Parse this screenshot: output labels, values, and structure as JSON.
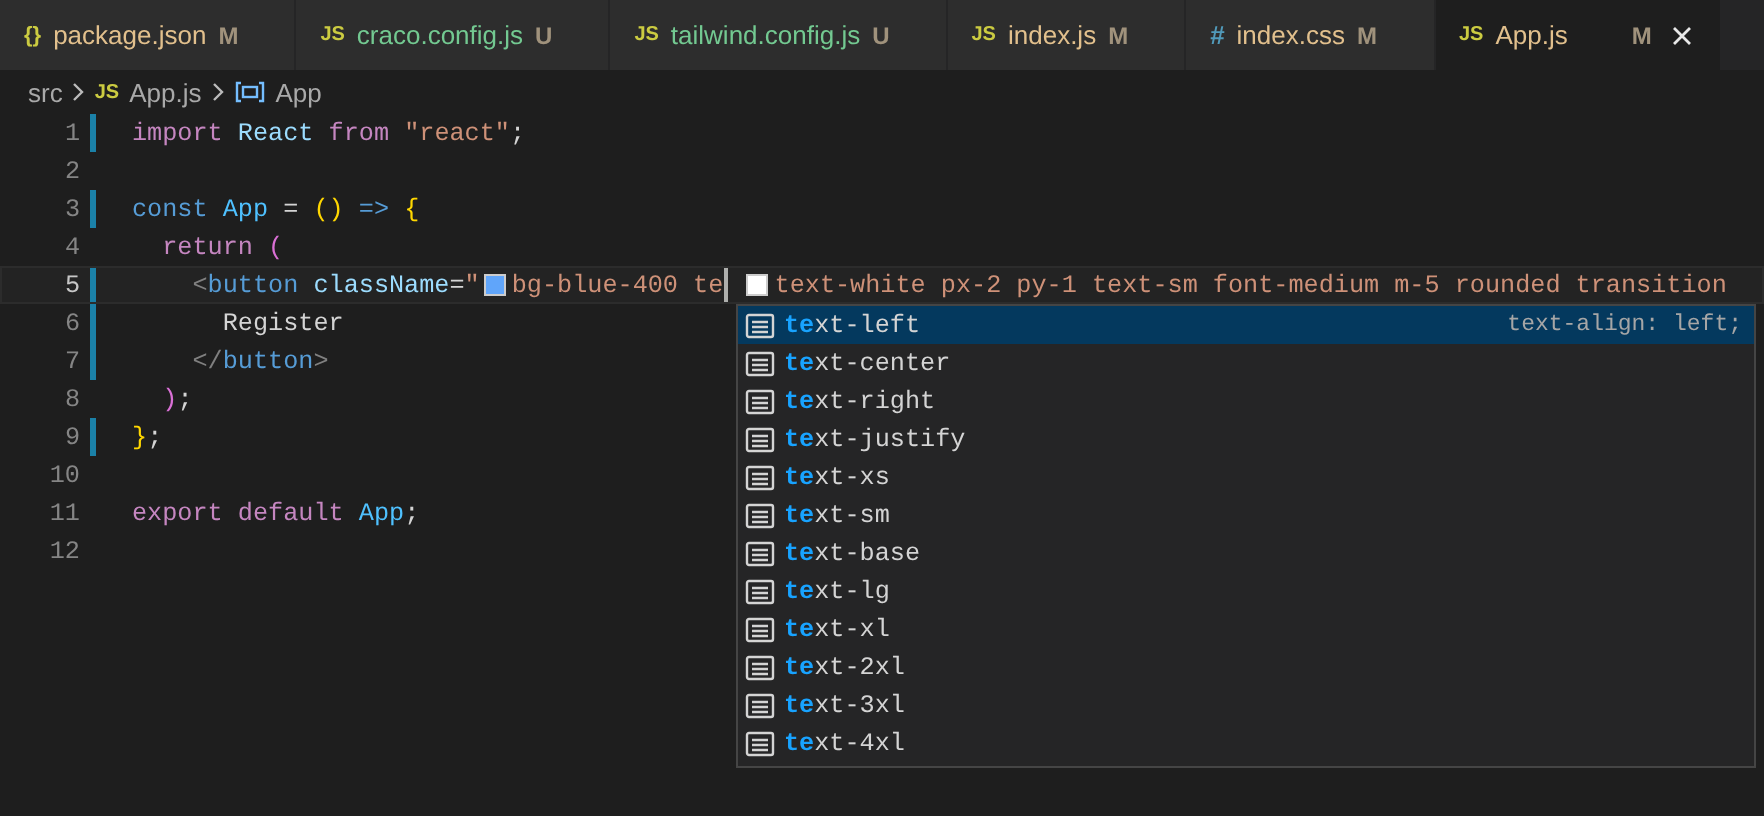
{
  "tabs": [
    {
      "icon": "{}",
      "kind": "json",
      "label": "package.json",
      "status": "M",
      "selected": false
    },
    {
      "icon": "JS",
      "kind": "js",
      "label": "craco.config.js",
      "status": "U",
      "selected": false
    },
    {
      "icon": "JS",
      "kind": "js",
      "label": "tailwind.config.js",
      "status": "U",
      "selected": false
    },
    {
      "icon": "JS",
      "kind": "js",
      "label": "index.js",
      "status": "M",
      "selected": false
    },
    {
      "icon": "#",
      "kind": "css",
      "label": "index.css",
      "status": "M",
      "selected": false
    },
    {
      "icon": "JS",
      "kind": "js",
      "label": "App.js",
      "status": "M",
      "selected": true
    }
  ],
  "breadcrumb": [
    {
      "kind": "folder",
      "label": "src"
    },
    {
      "kind": "file",
      "icon": "JS",
      "label": "App.js"
    },
    {
      "kind": "symbol",
      "label": "App"
    }
  ],
  "lines": [
    {
      "number": "1",
      "modified": true,
      "current": false,
      "tokens": [
        {
          "kind": "keyword",
          "text": "import"
        },
        {
          "kind": "variable",
          "text": " React"
        },
        {
          "kind": "keyword",
          "text": " from"
        },
        {
          "kind": "string",
          "text": " \"react\""
        },
        {
          "kind": "plain",
          "text": ";"
        }
      ]
    },
    {
      "number": "2",
      "modified": false,
      "current": false
    },
    {
      "number": "3",
      "modified": true,
      "current": false,
      "tokens": [
        {
          "kind": "storage",
          "text": "const"
        },
        {
          "kind": "constant",
          "text": " App"
        },
        {
          "kind": "plain",
          "text": " = "
        },
        {
          "kind": "bracket1",
          "text": "()"
        },
        {
          "kind": "storage",
          "text": " =>"
        },
        {
          "kind": "bracket1",
          "text": " {"
        }
      ]
    },
    {
      "number": "4",
      "modified": false,
      "current": false,
      "tokens": [
        {
          "kind": "keyword",
          "text": "  return"
        },
        {
          "kind": "bracket2",
          "text": " ("
        }
      ]
    },
    {
      "number": "5",
      "modified": true,
      "current": true,
      "tokens": [
        {
          "kind": "tagpunct",
          "text": "    <"
        },
        {
          "kind": "tag",
          "text": "button"
        },
        {
          "kind": "attr",
          "text": " className"
        },
        {
          "kind": "plain",
          "text": "="
        },
        {
          "kind": "string",
          "text": "\""
        },
        {
          "kind": "swatch",
          "color": "#60a5fa"
        },
        {
          "kind": "string",
          "text": "bg-blue-400 te"
        },
        {
          "kind": "cursor"
        },
        {
          "kind": "swatch",
          "color": "#ffffff"
        },
        {
          "kind": "string",
          "text": "text-white px-2 py-1 text-sm font-medium m-5 rounded transition"
        }
      ]
    },
    {
      "number": "6",
      "modified": true,
      "current": false,
      "tokens": [
        {
          "kind": "plain",
          "text": "      Register"
        }
      ]
    },
    {
      "number": "7",
      "modified": true,
      "current": false,
      "tokens": [
        {
          "kind": "tagpunct",
          "text": "    </"
        },
        {
          "kind": "tag",
          "text": "button"
        },
        {
          "kind": "tagpunct",
          "text": ">"
        }
      ]
    },
    {
      "number": "8",
      "modified": false,
      "current": false,
      "tokens": [
        {
          "kind": "bracket2",
          "text": "  )"
        },
        {
          "kind": "plain",
          "text": ";"
        }
      ]
    },
    {
      "number": "9",
      "modified": true,
      "current": false,
      "tokens": [
        {
          "kind": "bracket1",
          "text": "}"
        },
        {
          "kind": "plain",
          "text": ";"
        }
      ]
    },
    {
      "number": "10",
      "modified": false,
      "current": false
    },
    {
      "number": "11",
      "modified": false,
      "current": false,
      "tokens": [
        {
          "kind": "keyword",
          "text": "export"
        },
        {
          "kind": "keyword",
          "text": " default"
        },
        {
          "kind": "constant",
          "text": " App"
        },
        {
          "kind": "plain",
          "text": ";"
        }
      ]
    },
    {
      "number": "12",
      "modified": false,
      "current": false
    }
  ],
  "suggestions": [
    {
      "match": "te",
      "rest": "xt-left",
      "detail": "text-align: left;",
      "selected": true
    },
    {
      "match": "te",
      "rest": "xt-center",
      "selected": false
    },
    {
      "match": "te",
      "rest": "xt-right",
      "selected": false
    },
    {
      "match": "te",
      "rest": "xt-justify",
      "selected": false
    },
    {
      "match": "te",
      "rest": "xt-xs",
      "selected": false
    },
    {
      "match": "te",
      "rest": "xt-sm",
      "selected": false
    },
    {
      "match": "te",
      "rest": "xt-base",
      "selected": false
    },
    {
      "match": "te",
      "rest": "xt-lg",
      "selected": false
    },
    {
      "match": "te",
      "rest": "xt-xl",
      "selected": false
    },
    {
      "match": "te",
      "rest": "xt-2xl",
      "selected": false
    },
    {
      "match": "te",
      "rest": "xt-3xl",
      "selected": false
    },
    {
      "match": "te",
      "rest": "xt-4xl",
      "selected": false
    }
  ]
}
